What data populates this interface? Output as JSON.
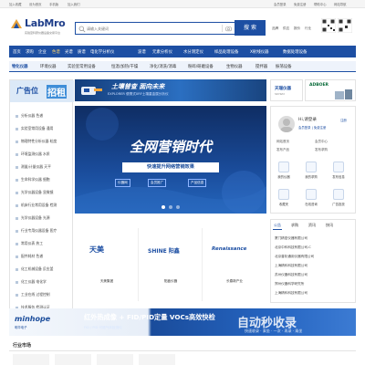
{
  "topbar": {
    "links": [
      "加入收藏",
      "设为首页",
      "手机版",
      "加入我们"
    ],
    "right_links": [
      "会员登录",
      "免费注册",
      "帮助中心",
      "网站导航"
    ]
  },
  "logo": {
    "text": "LabMro",
    "tagline": "实验室科研仪器设备交易平台"
  },
  "search": {
    "placeholder": "请输入关键词",
    "button": "搜 索"
  },
  "header_links": [
    "品牌",
    "供应",
    "报价",
    "行业"
  ],
  "nav_primary": [
    "首页",
    "求购",
    "企业",
    "色谱",
    "光谱",
    "质谱",
    "电化学分析仪",
    "波谱",
    "元素分析仪",
    "水分测定仪",
    "样品处理设备",
    "X射线仪器",
    "数据处理设备"
  ],
  "nav_secondary": [
    "物化仪器",
    "环境仪器",
    "实验室常用设备",
    "恒温/加热/干燥",
    "净化/消洗/消毒",
    "粉碎/研磨设备",
    "生物仪器",
    "搅拌器",
    "振荡设备"
  ],
  "sidebar": {
    "ad_text": "广告位",
    "ad_badge": "招租",
    "items": [
      "分析仪器 色谱",
      "实验室常用设备 通用",
      "物理特性分析仪器 粒度",
      "环境监测仪器 水质",
      "测量/计量仪器 天平",
      "生命科学仪器 细胞",
      "光学仪器设备 显微镜",
      "机床行业常用设备 检测",
      "光学仪器设备 光源",
      "行业专用仪器设备 医疗",
      "常用仪表 热工",
      "配件耗材 色谱",
      "化工机械设备 反应釜",
      "化工仪器 电化学",
      "工业在线 过程控制",
      "技术服务 检测认证"
    ]
  },
  "banner_top": {
    "title": "土壤普查 面向未来",
    "subtitle": "EXPLORER 便携式XRF土壤重金属分析仪"
  },
  "ad_tianyao": {
    "title": "天瑞仪器",
    "subtitle": "SKYRAY"
  },
  "ad_adboer": {
    "title": "ADBOER"
  },
  "hero": {
    "title": "全网营销时代",
    "subtitle": "快速提升网络营销效果",
    "tags": [
      "仪器网",
      "会员推广",
      "产品信息"
    ]
  },
  "partners": [
    {
      "logo": "天美",
      "name": "天美集团"
    },
    {
      "logo": "SHINE 阳鑫",
      "name": "阳鑫仪器"
    },
    {
      "logo": "Renaissance",
      "name": "长春新产业"
    }
  ],
  "user": {
    "greeting": "Hi,请登录",
    "logout": "注册",
    "links": "会员登录 | 免费注册",
    "ops": [
      "网站首页",
      "会员中心",
      "发布产品",
      "发布求购"
    ],
    "quick": [
      "我的仪器",
      "我的求购",
      "发布信息",
      "收藏夹",
      "在线咨询",
      "广告投放"
    ]
  },
  "news": {
    "tabs": [
      "公告",
      "求购",
      "资讯",
      "快讯"
    ],
    "items": [
      "厦门精密仪器有限公司",
      "北京中科科技有限公司-C",
      "北京普析通用仪器有限公司",
      "上海精科科技有限公司",
      "苏州仪器科技有限公司",
      "郑州仪器科学研究所",
      "上海精科科技有限公司"
    ]
  },
  "bottom_ad": {
    "brand": "minhope",
    "brand_sub": "明华电子",
    "title": "红外热成像 + FID/PID定量 VOCs高效快检",
    "subtitle": "FID / PID 可燃气体检测仪",
    "mark": "自动秒收录",
    "mark_sub": "快速收录 · 乘坐 · 一次 · 再录 · 乘坐"
  },
  "section": {
    "title": "行业市场"
  },
  "colors": {
    "brand": "#1d4fa3",
    "nav_active": "#e8a23b"
  }
}
